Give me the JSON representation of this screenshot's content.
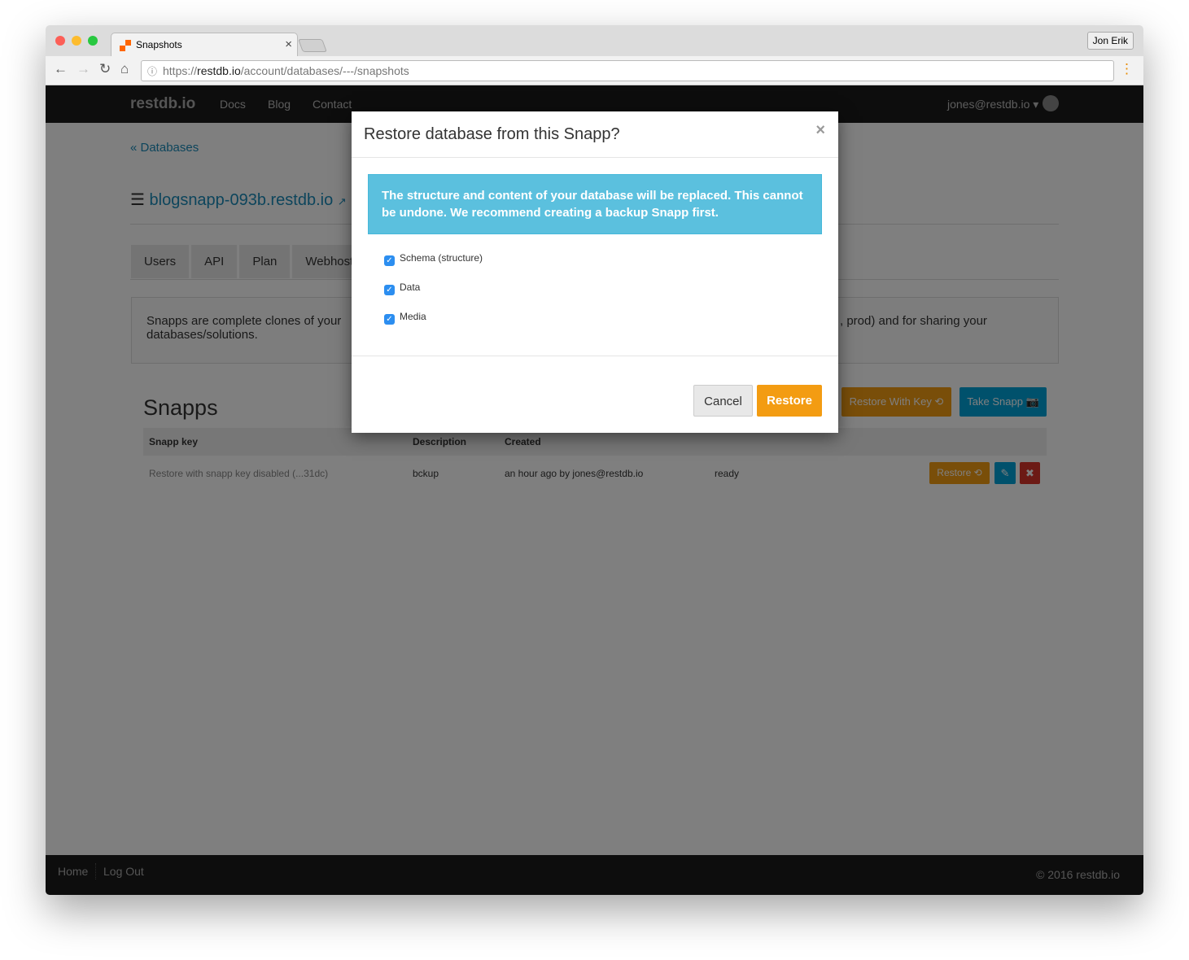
{
  "browser": {
    "tab_title": "Snapshots",
    "profile": "Jon Erik",
    "url_scheme": "https://",
    "url_host": "restdb.io",
    "url_path": "/account/databases/---/snapshots"
  },
  "nav": {
    "logo": "restdb.io",
    "links": [
      "Docs",
      "Blog",
      "Contact"
    ],
    "user": "jones@restdb.io"
  },
  "main": {
    "back": "« Databases",
    "db_name": "blogsnapp-093b.restdb.io",
    "tabs": [
      "Users",
      "API",
      "Plan",
      "Webhost"
    ],
    "info_left": "Snapps are complete clones of your",
    "info_right": ", prod) and for sharing your",
    "info_line2": "databases/solutions.",
    "section_title": "Snapps",
    "restore_with_key": "Restore With Key ⟲",
    "take_snapp": "Take Snapp 📷",
    "columns": [
      "Snapp key",
      "Description",
      "Created"
    ],
    "rows": [
      {
        "key": "Restore with snapp key disabled (...31dc)",
        "description": "bckup",
        "created": "an hour ago by jones@restdb.io",
        "status": "ready",
        "restore": "Restore ⟲"
      }
    ]
  },
  "modal": {
    "title": "Restore database from this Snapp?",
    "close": "×",
    "alert": "The structure and content of your database will be replaced. This cannot be undone. We recommend creating a backup Snapp first.",
    "options": [
      "Schema (structure)",
      "Data",
      "Media"
    ],
    "cancel": "Cancel",
    "restore": "Restore"
  },
  "footer": {
    "links": [
      "Home",
      "Log Out"
    ],
    "copyright": "© 2016 restdb.io"
  },
  "colors": {
    "orange": "#f39c12",
    "blue": "#00a3d9",
    "alert": "#5bc0de",
    "danger": "#d9342b"
  }
}
